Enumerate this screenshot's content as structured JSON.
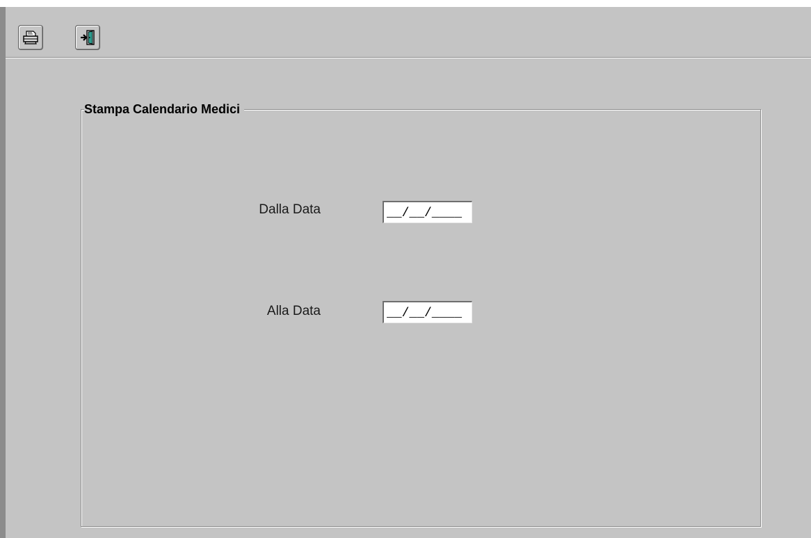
{
  "toolbar": {
    "buttons": [
      {
        "name": "print",
        "icon": "printer-icon"
      },
      {
        "name": "exit",
        "icon": "exit-door-icon"
      }
    ]
  },
  "group": {
    "title": "Stampa Calendario Medici"
  },
  "fields": {
    "from_label": "Dalla Data",
    "from_value": "__/__/____",
    "to_label": "Alla Data",
    "to_value": "__/__/____"
  },
  "colors": {
    "background": "#c4c4c4",
    "exit_icon_accent": "#2e9c8e"
  }
}
